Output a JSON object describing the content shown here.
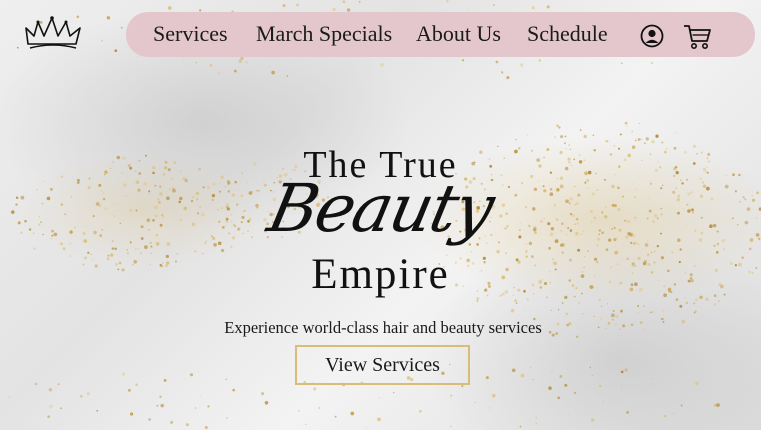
{
  "brand": {
    "logo_icon": "crown-icon"
  },
  "nav": {
    "items": [
      {
        "label": "Services"
      },
      {
        "label": "March Specials"
      },
      {
        "label": "About Us"
      },
      {
        "label": "Schedule"
      }
    ],
    "account_icon": "user-account-icon",
    "cart_icon": "shopping-cart-icon",
    "background": "#e3c7cd"
  },
  "hero": {
    "line1": "The True",
    "line2": "Beauty",
    "line3": "Empire",
    "subtitle": "Experience world-class hair and beauty services",
    "cta_label": "View Services",
    "accent": "#d8bc78"
  }
}
